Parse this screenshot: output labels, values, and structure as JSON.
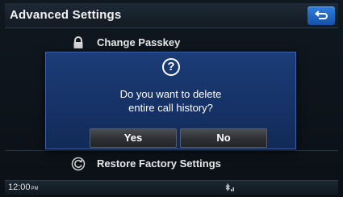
{
  "header": {
    "title": "Advanced Settings",
    "back_icon": "back-arrow-icon"
  },
  "list": {
    "items": [
      {
        "label": "Change Passkey",
        "icon": "lock-icon"
      },
      {
        "label": "Restore Factory Settings",
        "icon": "restore-icon"
      }
    ]
  },
  "dialog": {
    "icon": "question-icon",
    "icon_glyph": "?",
    "message_line1": "Do you want to delete",
    "message_line2": "entire call history?",
    "yes_label": "Yes",
    "no_label": "No"
  },
  "status_bar": {
    "time": "12:00",
    "ampm": "PM",
    "status_icon": "bluetooth-status-icon"
  },
  "colors": {
    "dialog_bg": "#163267",
    "back_button": "#1f63c4",
    "button_bg": "#2e3034"
  }
}
